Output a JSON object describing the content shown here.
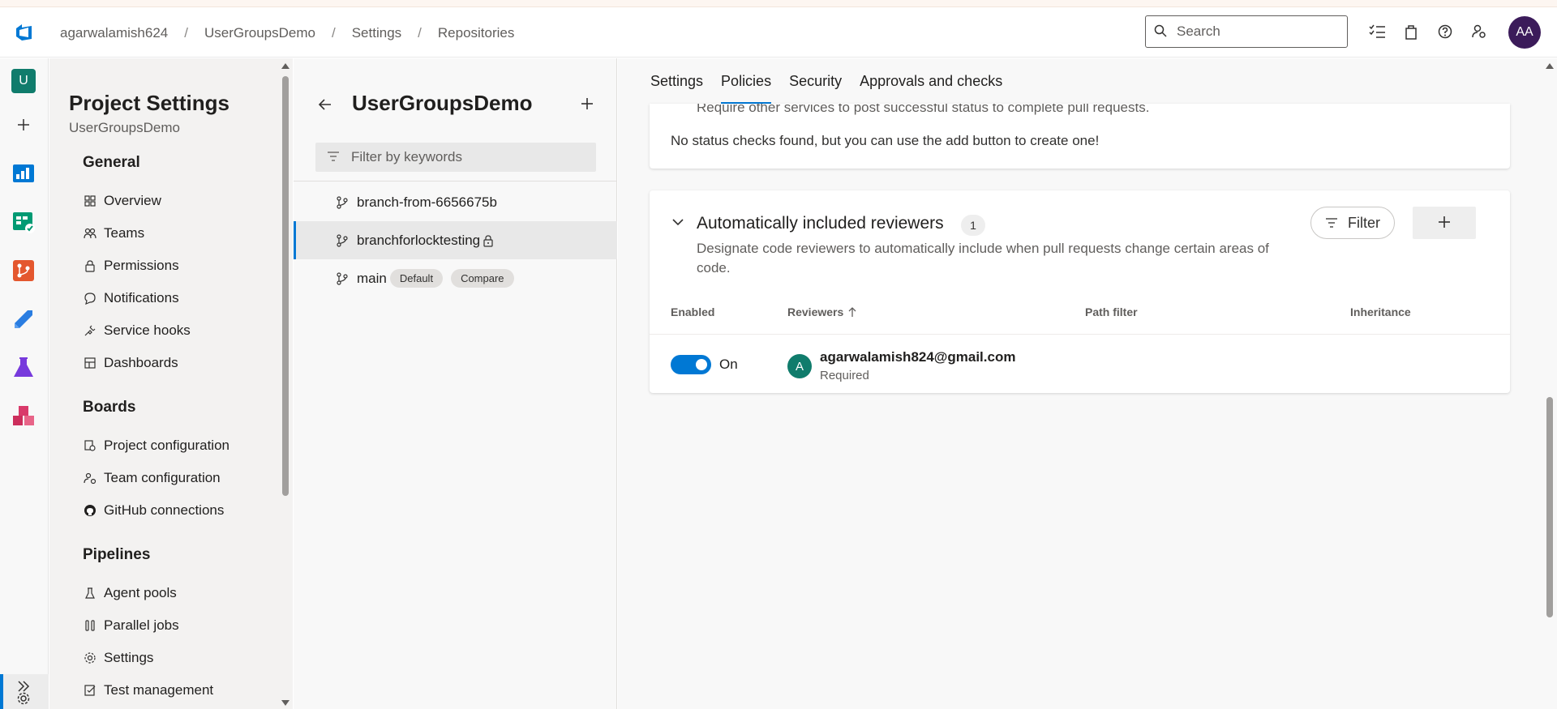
{
  "breadcrumb": [
    "agarwalamish624",
    "UserGroupsDemo",
    "Settings",
    "Repositories"
  ],
  "search": {
    "placeholder": "Search"
  },
  "user": {
    "initials": "AA"
  },
  "rail": {
    "project_initial": "U"
  },
  "nav": {
    "title": "Project Settings",
    "subtitle": "UserGroupsDemo",
    "groups": {
      "general": "General",
      "boards": "Boards",
      "pipelines": "Pipelines"
    },
    "items": {
      "overview": "Overview",
      "teams": "Teams",
      "permissions": "Permissions",
      "notifications": "Notifications",
      "service_hooks": "Service hooks",
      "dashboards": "Dashboards",
      "project_configuration": "Project configuration",
      "team_configuration": "Team configuration",
      "github_connections": "GitHub connections",
      "agent_pools": "Agent pools",
      "parallel_jobs": "Parallel jobs",
      "settings": "Settings",
      "test_management": "Test management"
    }
  },
  "branches": {
    "title": "UserGroupsDemo",
    "filter_placeholder": "Filter by keywords",
    "rows": [
      {
        "name": "branch-from-6656675b"
      },
      {
        "name": "branchforlocktesting"
      },
      {
        "name": "main",
        "badges": [
          "Default",
          "Compare"
        ]
      }
    ]
  },
  "tabs": [
    "Settings",
    "Policies",
    "Security",
    "Approvals and checks"
  ],
  "status_checks": {
    "partial_text": "Require other services to post successful status to complete pull requests.",
    "empty_message": "No status checks found, but you can use the add button to create one!"
  },
  "reviewers": {
    "title": "Automatically included reviewers",
    "count": "1",
    "description": "Designate code reviewers to automatically include when pull requests change certain areas of code.",
    "filter_label": "Filter",
    "columns": {
      "enabled": "Enabled",
      "reviewers": "Reviewers",
      "path_filter": "Path filter",
      "inheritance": "Inheritance"
    },
    "row": {
      "toggle_label": "On",
      "avatar": "A",
      "email": "agarwalamish824@gmail.com",
      "requirement": "Required"
    }
  }
}
